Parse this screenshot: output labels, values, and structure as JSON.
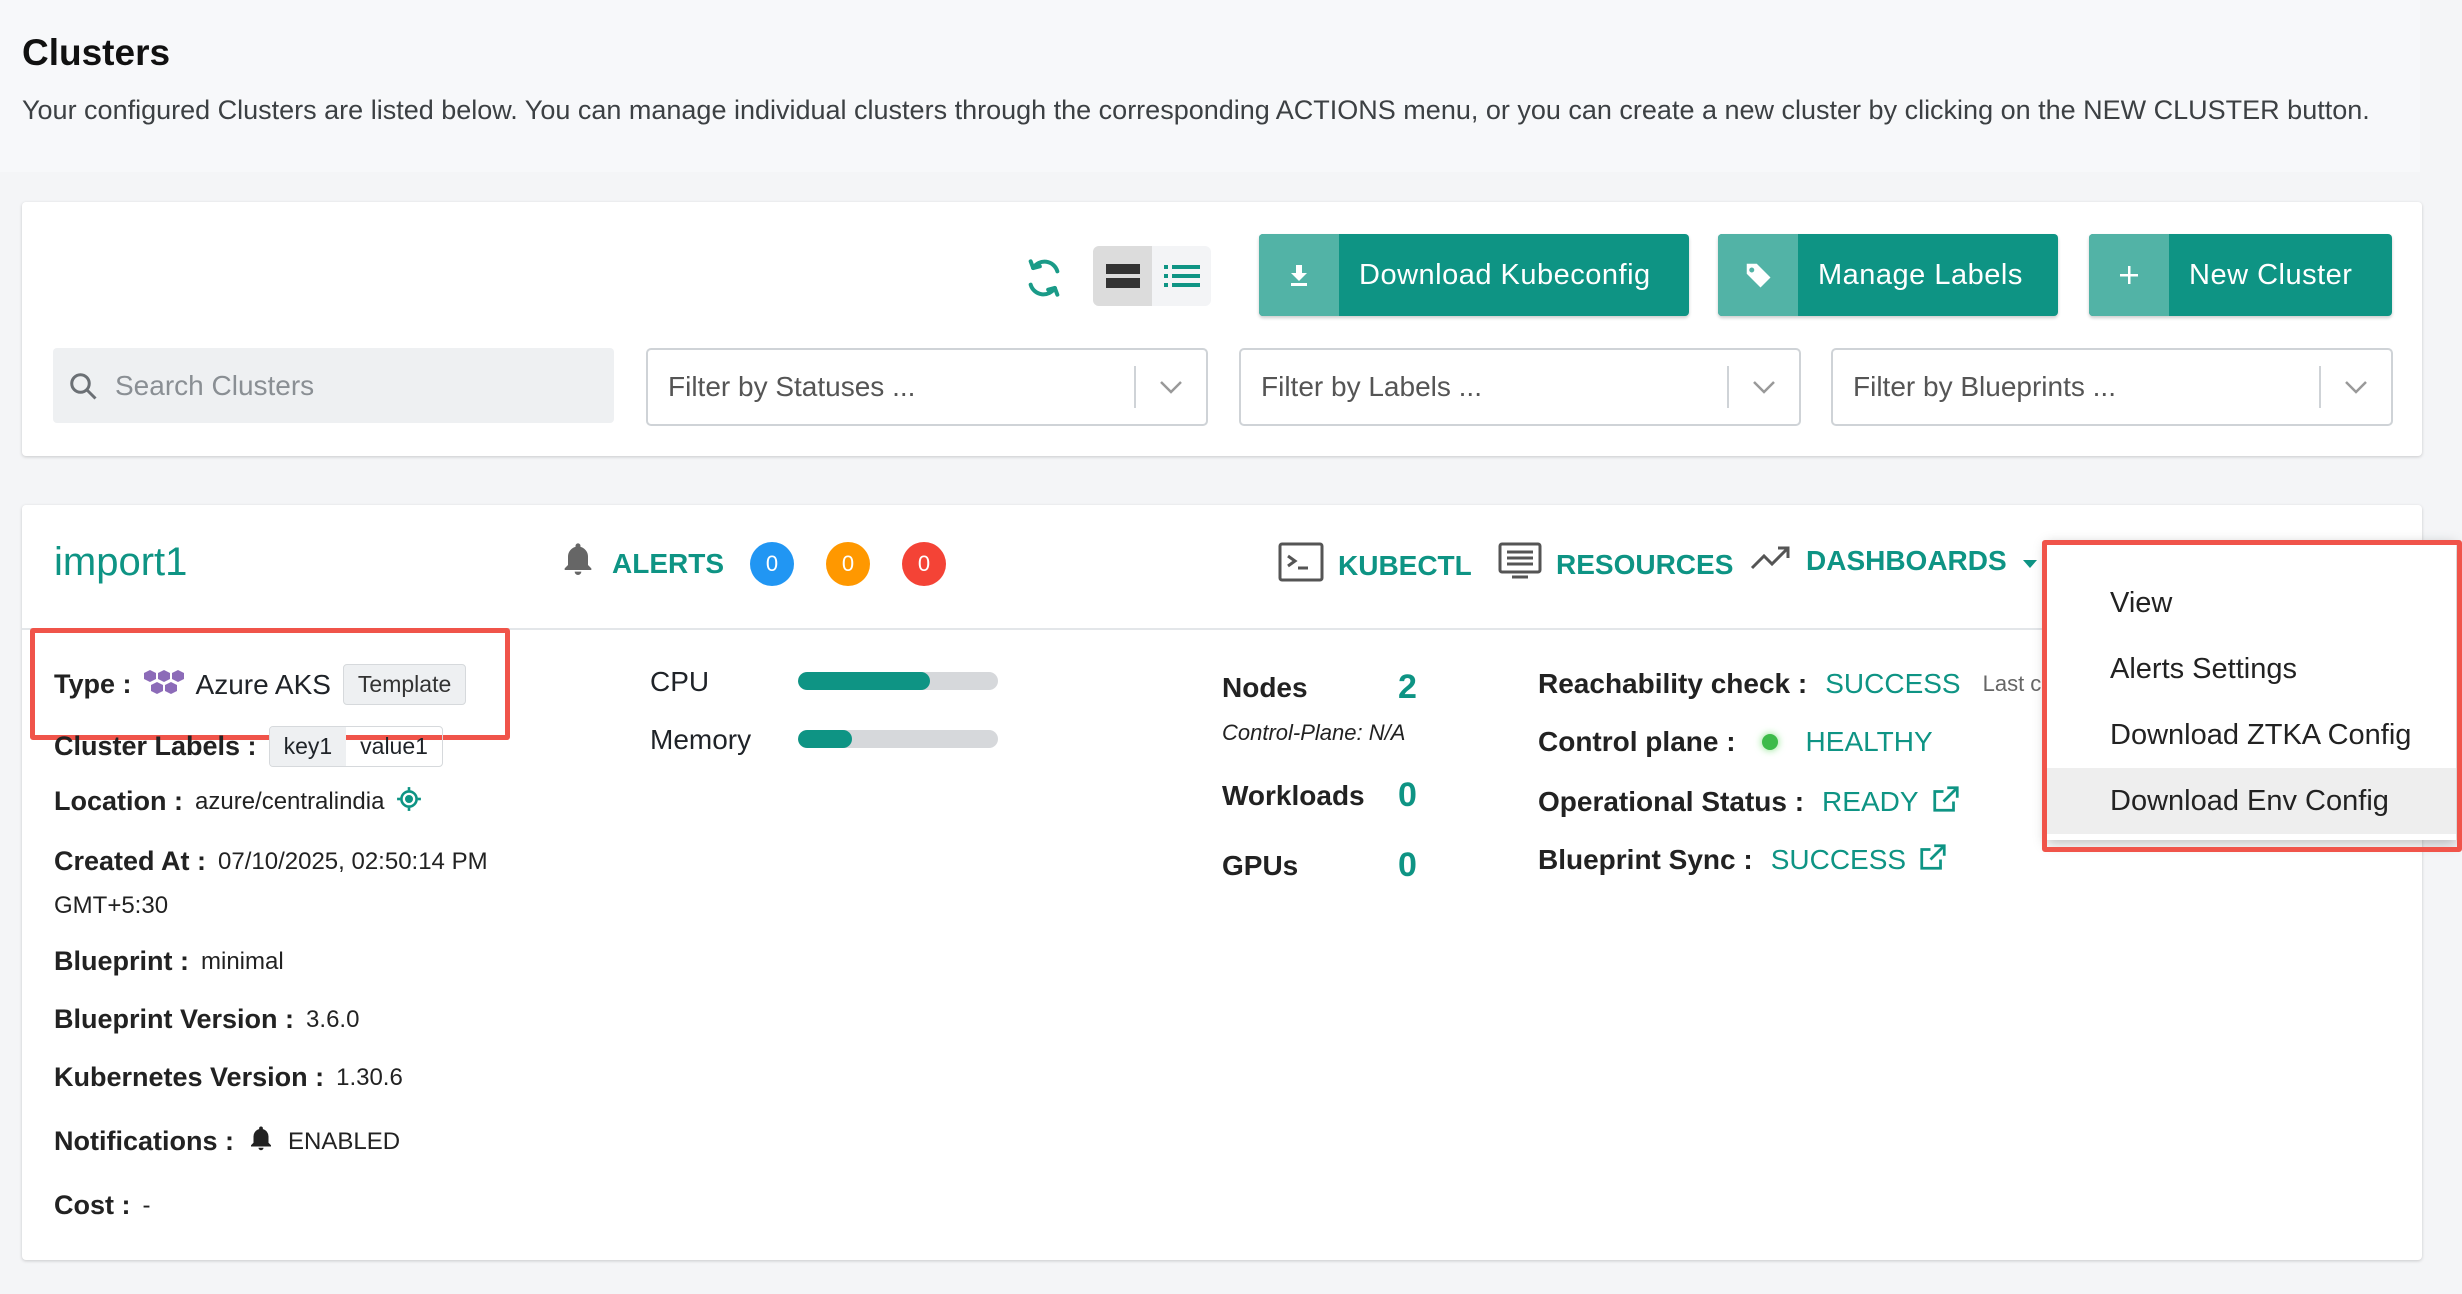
{
  "page": {
    "title": "Clusters",
    "description": "Your configured Clusters are listed below. You can manage individual clusters through the corresponding ACTIONS menu, or you can create a new cluster by clicking on the NEW CLUSTER button."
  },
  "toolbar": {
    "download_kubeconfig": "Download Kubeconfig",
    "manage_labels": "Manage Labels",
    "new_cluster": "New Cluster",
    "search_placeholder": "Search Clusters",
    "filter_statuses": "Filter by Statuses ...",
    "filter_labels": "Filter by Labels ...",
    "filter_blueprints": "Filter by Blueprints ..."
  },
  "cluster": {
    "name": "import1",
    "alerts_label": "ALERTS",
    "alert_counts": [
      "0",
      "0",
      "0"
    ],
    "kubectl": "KUBECTL",
    "resources": "RESOURCES",
    "dashboards": "DASHBOARDS",
    "type_label": "Type :",
    "type_value": "Azure AKS",
    "template_tag": "Template",
    "labels_label": "Cluster Labels :",
    "label_key": "key1",
    "label_value": "value1",
    "location_label": "Location :",
    "location_value": "azure/centralindia",
    "created_label": "Created At :",
    "created_value": "07/10/2025, 02:50:14 PM",
    "created_tz": "GMT+5:30",
    "blueprint_label": "Blueprint :",
    "blueprint_value": "minimal",
    "bp_version_label": "Blueprint Version :",
    "bp_version_value": "3.6.0",
    "k8s_version_label": "Kubernetes Version :",
    "k8s_version_value": "1.30.6",
    "notifications_label": "Notifications :",
    "notifications_value": "ENABLED",
    "cost_label": "Cost :",
    "cost_value": "-",
    "cpu_label": "CPU",
    "cpu_usage": 0.66,
    "memory_label": "Memory",
    "memory_usage": 0.27,
    "nodes_label": "Nodes",
    "nodes_value": "2",
    "control_plane_note": "Control-Plane: N/A",
    "workloads_label": "Workloads",
    "workloads_value": "0",
    "gpus_label": "GPUs",
    "gpus_value": "0",
    "reachability_label": "Reachability check :",
    "reachability_value": "SUCCESS",
    "last_checked": "Last chec",
    "control_plane_label": "Control plane :",
    "control_plane_value": "HEALTHY",
    "operational_label": "Operational Status :",
    "operational_value": "READY",
    "bp_sync_label": "Blueprint Sync :",
    "bp_sync_value": "SUCCESS"
  },
  "menu": {
    "items": [
      "View",
      "Alerts Settings",
      "Download ZTKA Config",
      "Download Env Config"
    ]
  },
  "colors": {
    "accent": "#0e9484",
    "highlight_box": "#f0544a",
    "badge_blue": "#2196f3",
    "badge_orange": "#ff9800",
    "badge_red": "#f44336"
  }
}
